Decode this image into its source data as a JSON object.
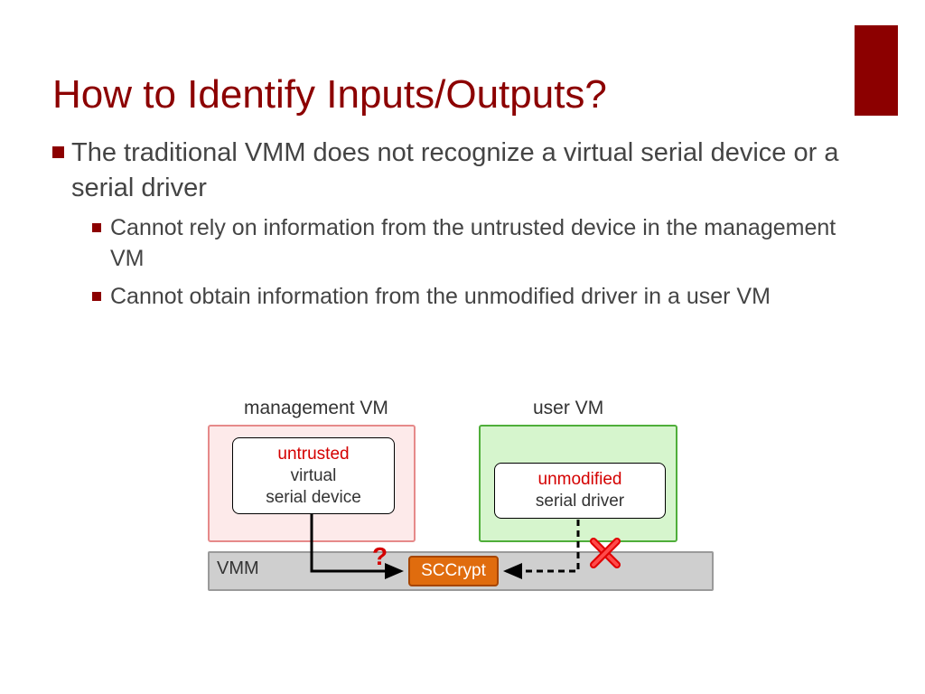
{
  "slide": {
    "title": "How to Identify Inputs/Outputs?",
    "bullet1": "The traditional VMM does not recognize a virtual serial device or a serial driver",
    "sub1": "Cannot rely on information from the untrusted device in the management VM",
    "sub2": "Cannot obtain information from the unmodified driver in a user VM"
  },
  "diagram": {
    "mgmt_label": "management VM",
    "user_label": "user VM",
    "mgmt_inner_red": "untrusted",
    "mgmt_inner_l2": "virtual",
    "mgmt_inner_l3": "serial device",
    "user_inner_red": "unmodified",
    "user_inner_l2": "serial driver",
    "vmm_label": "VMM",
    "sccrypt_label": "SCCrypt",
    "question": "?"
  }
}
